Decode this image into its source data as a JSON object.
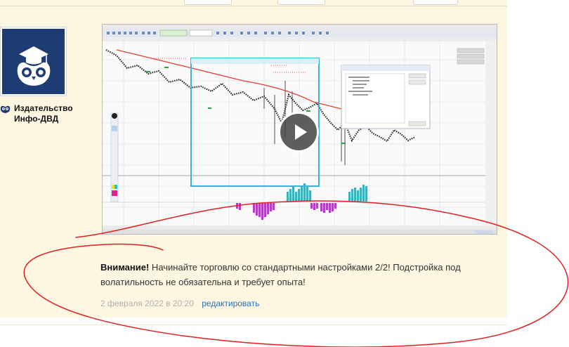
{
  "author": {
    "name": "Издательство Инфо-ДВД"
  },
  "comment": {
    "bold_prefix": "Внимание!",
    "text": " Начинайте торговлю со стандартными настройками 2/2! Подстройка под волатильность не обязательна и требует опыта!",
    "date": "2 февраля 2022 в 20:20",
    "edit_label": "редактировать"
  },
  "video": {
    "play_label": "▶"
  },
  "colors": {
    "page_bg": "#fdf7e2",
    "avatar_bg": "#1d3c74",
    "link": "#2f6eb5",
    "annotation": "#e02020",
    "chart_ma": "#e0403a",
    "histogram_pos": "#40b0b8",
    "histogram_neg": "#b040c0"
  }
}
